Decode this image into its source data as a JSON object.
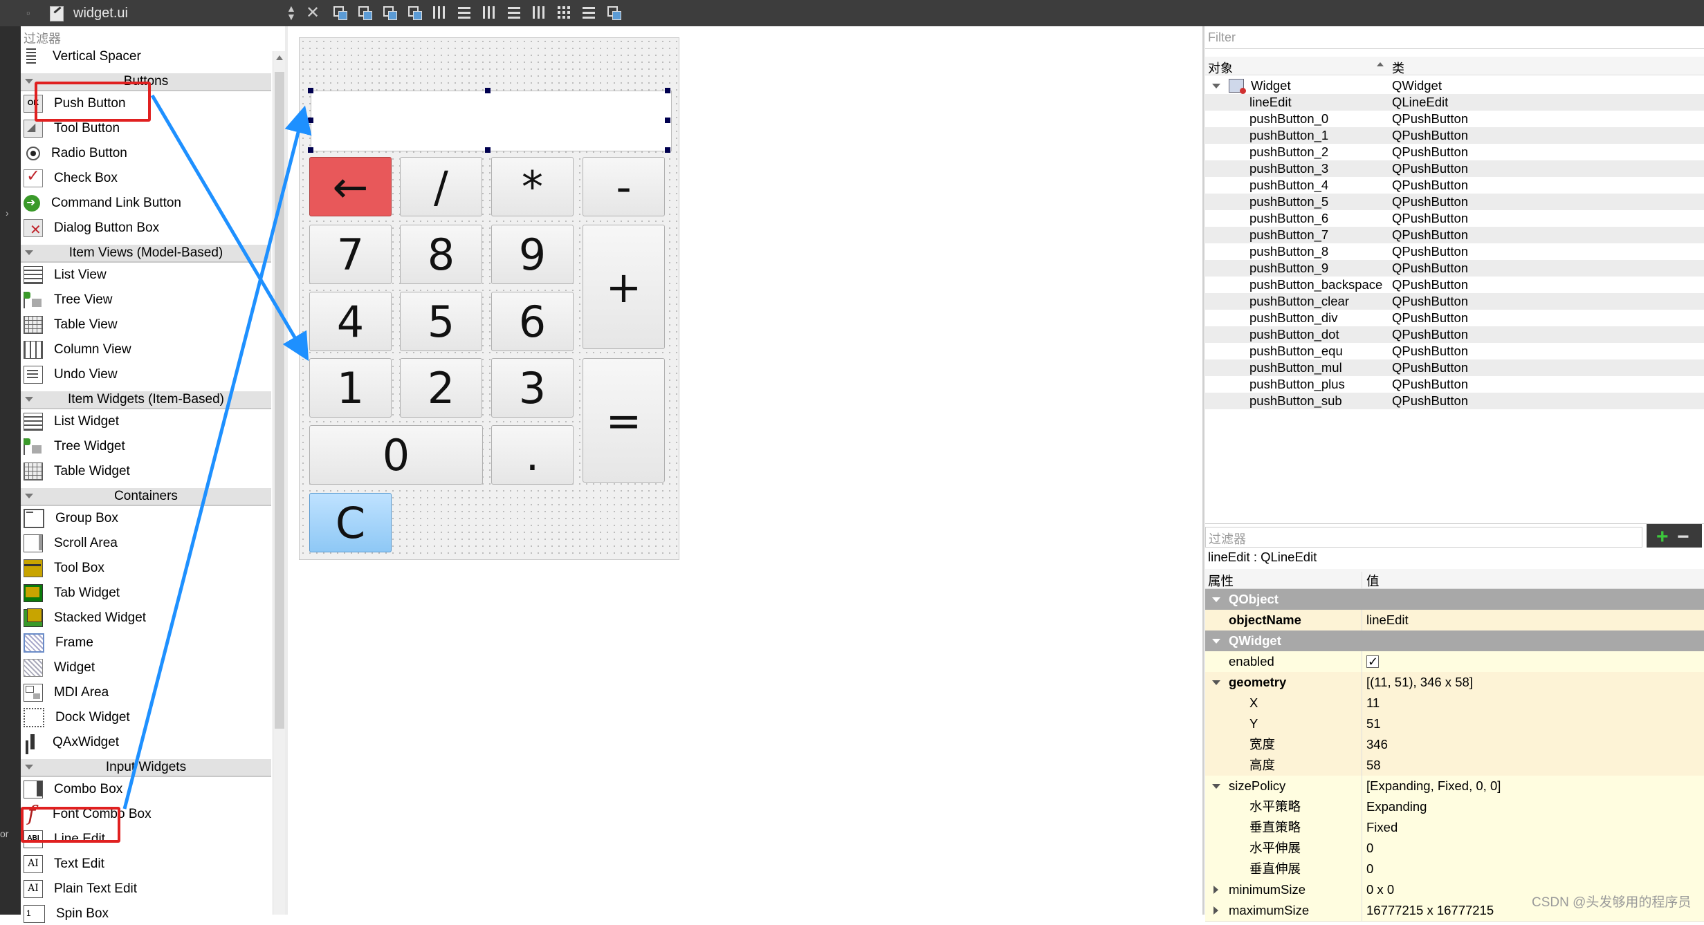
{
  "toolbar": {
    "file_name": "widget.ui",
    "close_symbol": "✕"
  },
  "left_strip": {
    "cut_label": "or"
  },
  "widget_box": {
    "filter_placeholder": "过滤器",
    "items": [
      {
        "type": "item",
        "label": "Vertical Spacer",
        "icon": "vertical-spacer-icon",
        "cls": "i-spacer"
      },
      {
        "type": "category",
        "label": "Buttons"
      },
      {
        "type": "item",
        "label": "Push Button",
        "icon": "push-button-icon",
        "cls": "i-push",
        "glyph": "OK"
      },
      {
        "type": "item",
        "label": "Tool Button",
        "icon": "tool-button-icon",
        "cls": "i-tool"
      },
      {
        "type": "item",
        "label": "Radio Button",
        "icon": "radio-button-icon",
        "cls": "i-radio"
      },
      {
        "type": "item",
        "label": "Check Box",
        "icon": "check-box-icon",
        "cls": "i-check"
      },
      {
        "type": "item",
        "label": "Command Link Button",
        "icon": "command-link-icon",
        "cls": "i-cmd"
      },
      {
        "type": "item",
        "label": "Dialog Button Box",
        "icon": "dialog-button-box-icon",
        "cls": "i-dlg"
      },
      {
        "type": "category",
        "label": "Item Views (Model-Based)"
      },
      {
        "type": "item",
        "label": "List View",
        "icon": "list-view-icon",
        "cls": "i-list"
      },
      {
        "type": "item",
        "label": "Tree View",
        "icon": "tree-view-icon",
        "cls": "i-tree"
      },
      {
        "type": "item",
        "label": "Table View",
        "icon": "table-view-icon",
        "cls": "i-table"
      },
      {
        "type": "item",
        "label": "Column View",
        "icon": "column-view-icon",
        "cls": "i-column"
      },
      {
        "type": "item",
        "label": "Undo View",
        "icon": "undo-view-icon",
        "cls": "i-undo"
      },
      {
        "type": "category",
        "label": "Item Widgets (Item-Based)"
      },
      {
        "type": "item",
        "label": "List Widget",
        "icon": "list-widget-icon",
        "cls": "i-list"
      },
      {
        "type": "item",
        "label": "Tree Widget",
        "icon": "tree-widget-icon",
        "cls": "i-tree"
      },
      {
        "type": "item",
        "label": "Table Widget",
        "icon": "table-widget-icon",
        "cls": "i-table"
      },
      {
        "type": "category",
        "label": "Containers"
      },
      {
        "type": "item",
        "label": "Group Box",
        "icon": "group-box-icon",
        "cls": "i-group"
      },
      {
        "type": "item",
        "label": "Scroll Area",
        "icon": "scroll-area-icon",
        "cls": "i-scroll"
      },
      {
        "type": "item",
        "label": "Tool Box",
        "icon": "tool-box-icon",
        "cls": "i-toolbox"
      },
      {
        "type": "item",
        "label": "Tab Widget",
        "icon": "tab-widget-icon",
        "cls": "i-tab"
      },
      {
        "type": "item",
        "label": "Stacked Widget",
        "icon": "stacked-widget-icon",
        "cls": "i-stack"
      },
      {
        "type": "item",
        "label": "Frame",
        "icon": "frame-icon",
        "cls": "i-frame"
      },
      {
        "type": "item",
        "label": "Widget",
        "icon": "widget-icon",
        "cls": "i-widget"
      },
      {
        "type": "item",
        "label": "MDI Area",
        "icon": "mdi-area-icon",
        "cls": "i-mdi"
      },
      {
        "type": "item",
        "label": "Dock Widget",
        "icon": "dock-widget-icon",
        "cls": "i-dock"
      },
      {
        "type": "item",
        "label": "QAxWidget",
        "icon": "qaxwidget-icon",
        "cls": "i-qax"
      },
      {
        "type": "category",
        "label": "Input Widgets"
      },
      {
        "type": "item",
        "label": "Combo Box",
        "icon": "combo-box-icon",
        "cls": "i-combo"
      },
      {
        "type": "item",
        "label": "Font Combo Box",
        "icon": "font-combo-box-icon",
        "cls": "i-font"
      },
      {
        "type": "item",
        "label": "Line Edit",
        "icon": "line-edit-icon",
        "cls": "i-lineedit",
        "glyph": "ABI"
      },
      {
        "type": "item",
        "label": "Text Edit",
        "icon": "text-edit-icon",
        "cls": "i-textedit",
        "glyph": "AI"
      },
      {
        "type": "item",
        "label": "Plain Text Edit",
        "icon": "plain-text-edit-icon",
        "cls": "i-textedit",
        "glyph": "AI"
      },
      {
        "type": "item",
        "label": "Spin Box",
        "icon": "spin-box-icon",
        "cls": "i-spin",
        "glyph": "1"
      }
    ]
  },
  "calculator": {
    "buttons": [
      {
        "name": "backspace-button",
        "label": "←",
        "style": "back"
      },
      {
        "name": "div-button",
        "label": "/"
      },
      {
        "name": "mul-button",
        "label": "*"
      },
      {
        "name": "sub-button",
        "label": "-"
      },
      {
        "name": "digit-7-button",
        "label": "7"
      },
      {
        "name": "digit-8-button",
        "label": "8"
      },
      {
        "name": "digit-9-button",
        "label": "9"
      },
      {
        "name": "plus-button",
        "label": "+"
      },
      {
        "name": "digit-4-button",
        "label": "4"
      },
      {
        "name": "digit-5-button",
        "label": "5"
      },
      {
        "name": "digit-6-button",
        "label": "6"
      },
      {
        "name": "digit-1-button",
        "label": "1"
      },
      {
        "name": "digit-2-button",
        "label": "2"
      },
      {
        "name": "digit-3-button",
        "label": "3"
      },
      {
        "name": "equals-button",
        "label": "="
      },
      {
        "name": "digit-0-button",
        "label": "0"
      },
      {
        "name": "dot-button",
        "label": "."
      },
      {
        "name": "clear-button",
        "label": "C",
        "style": "clear"
      }
    ]
  },
  "object_inspector": {
    "filter_placeholder": "Filter",
    "col_object": "对象",
    "col_class": "类",
    "rows": [
      {
        "object": "Widget",
        "class": "QWidget",
        "root": true
      },
      {
        "object": "lineEdit",
        "class": "QLineEdit"
      },
      {
        "object": "pushButton_0",
        "class": "QPushButton"
      },
      {
        "object": "pushButton_1",
        "class": "QPushButton"
      },
      {
        "object": "pushButton_2",
        "class": "QPushButton"
      },
      {
        "object": "pushButton_3",
        "class": "QPushButton"
      },
      {
        "object": "pushButton_4",
        "class": "QPushButton"
      },
      {
        "object": "pushButton_5",
        "class": "QPushButton"
      },
      {
        "object": "pushButton_6",
        "class": "QPushButton"
      },
      {
        "object": "pushButton_7",
        "class": "QPushButton"
      },
      {
        "object": "pushButton_8",
        "class": "QPushButton"
      },
      {
        "object": "pushButton_9",
        "class": "QPushButton"
      },
      {
        "object": "pushButton_backspace",
        "class": "QPushButton"
      },
      {
        "object": "pushButton_clear",
        "class": "QPushButton"
      },
      {
        "object": "pushButton_div",
        "class": "QPushButton"
      },
      {
        "object": "pushButton_dot",
        "class": "QPushButton"
      },
      {
        "object": "pushButton_equ",
        "class": "QPushButton"
      },
      {
        "object": "pushButton_mul",
        "class": "QPushButton"
      },
      {
        "object": "pushButton_plus",
        "class": "QPushButton"
      },
      {
        "object": "pushButton_sub",
        "class": "QPushButton"
      }
    ]
  },
  "property_editor": {
    "filter_placeholder": "过滤器",
    "add_symbol": "+",
    "remove_symbol": "−",
    "title": "lineEdit : QLineEdit",
    "col_property": "属性",
    "col_value": "值",
    "rows": [
      {
        "kind": "section",
        "key": "QObject",
        "value": ""
      },
      {
        "kind": "peach",
        "key": "objectName",
        "value": "lineEdit",
        "bold": true
      },
      {
        "kind": "section",
        "key": "QWidget",
        "value": ""
      },
      {
        "kind": "yellow",
        "key": "enabled",
        "value": "",
        "check": true
      },
      {
        "kind": "peach",
        "key": "geometry",
        "value": "[(11, 51), 346 x 58]",
        "bold": true,
        "expand": "down"
      },
      {
        "kind": "peach",
        "key": "X",
        "value": "11",
        "sub": true
      },
      {
        "kind": "peach",
        "key": "Y",
        "value": "51",
        "sub": true
      },
      {
        "kind": "peach",
        "key": "宽度",
        "value": "346",
        "sub": true
      },
      {
        "kind": "peach",
        "key": "高度",
        "value": "58",
        "sub": true
      },
      {
        "kind": "yellow",
        "key": "sizePolicy",
        "value": "[Expanding, Fixed, 0, 0]",
        "expand": "down"
      },
      {
        "kind": "yellow",
        "key": "水平策略",
        "value": "Expanding",
        "sub": true
      },
      {
        "kind": "yellow",
        "key": "垂直策略",
        "value": "Fixed",
        "sub": true
      },
      {
        "kind": "yellow",
        "key": "水平伸展",
        "value": "0",
        "sub": true
      },
      {
        "kind": "yellow",
        "key": "垂直伸展",
        "value": "0",
        "sub": true
      },
      {
        "kind": "yellow",
        "key": "minimumSize",
        "value": "0 x 0",
        "expand": "right"
      },
      {
        "kind": "yellow",
        "key": "maximumSize",
        "value": "16777215 x 16777215",
        "expand": "right"
      }
    ]
  },
  "watermark": "CSDN @头发够用的程序员",
  "annotation_color": "#1e90ff",
  "highlight_color": "#e02020"
}
